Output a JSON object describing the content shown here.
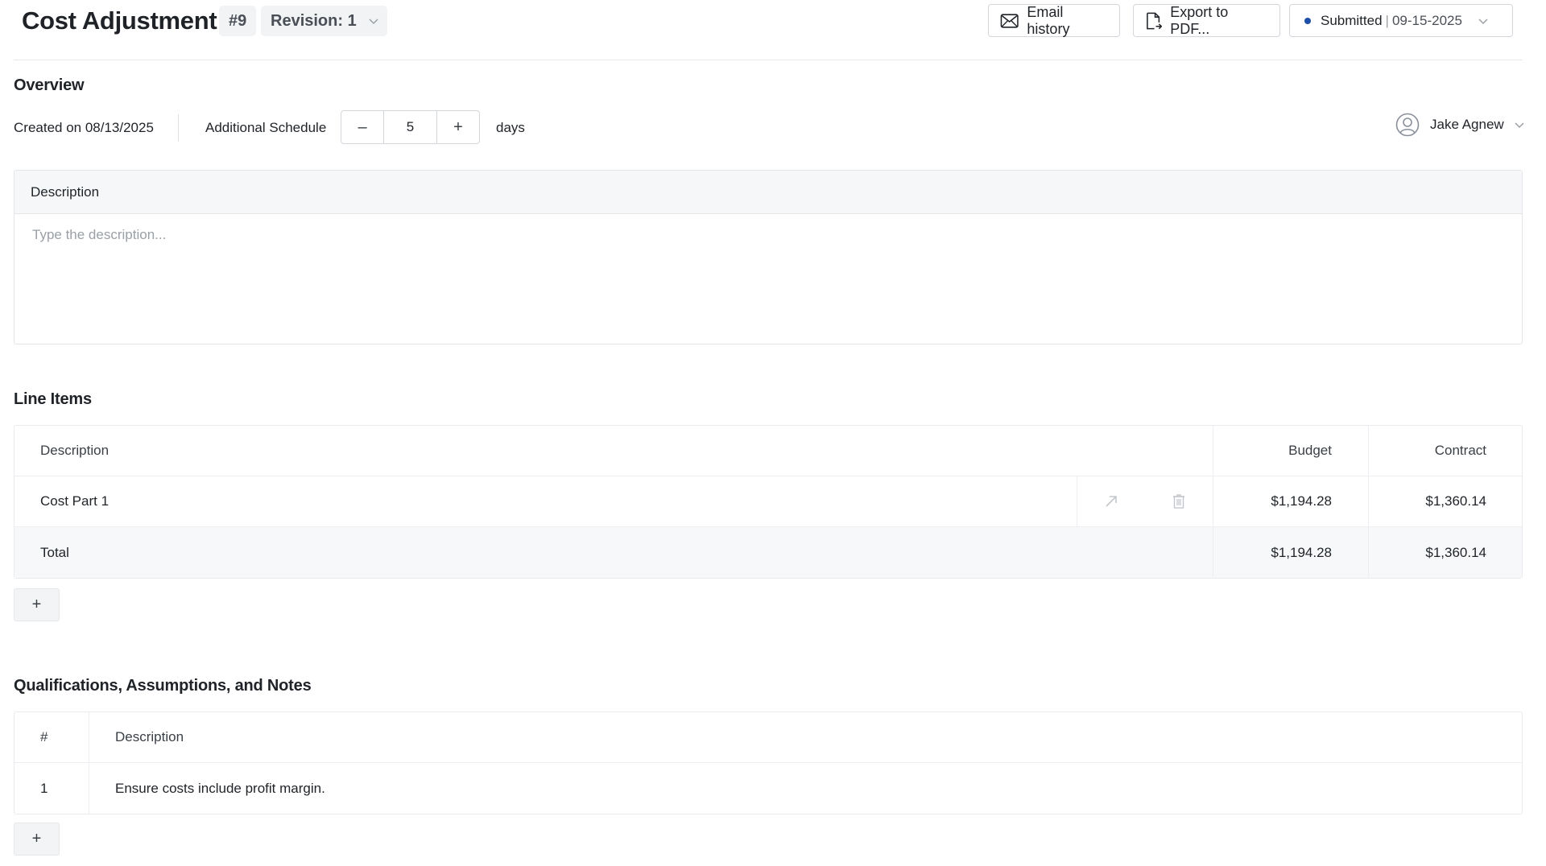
{
  "header": {
    "title": "Cost Adjustment",
    "number": "#9",
    "revision_label": "Revision: 1",
    "email_history_label": "Email history",
    "export_pdf_label": "Export to PDF...",
    "status_label": "Submitted",
    "status_separator": "|",
    "status_date": "09-15-2025",
    "status_color": "#1d4ea8"
  },
  "overview": {
    "section_title": "Overview",
    "created_text": "Created on 08/13/2025",
    "schedule_label": "Additional Schedule",
    "stepper_decrement": "–",
    "stepper_value": "5",
    "stepper_increment": "+",
    "unit_label": "days",
    "user_name": "Jake Agnew"
  },
  "description": {
    "header": "Description",
    "value": "",
    "placeholder": "Type the description..."
  },
  "line_items": {
    "section_title": "Line Items",
    "columns": {
      "description": "Description",
      "budget": "Budget",
      "contract": "Contract"
    },
    "rows": [
      {
        "description": "Cost Part 1",
        "budget": "$1,194.28",
        "contract": "$1,360.14"
      }
    ],
    "total": {
      "label": "Total",
      "budget": "$1,194.28",
      "contract": "$1,360.14"
    },
    "add_label": "+"
  },
  "notes": {
    "section_title": "Qualifications, Assumptions, and Notes",
    "columns": {
      "number": "#",
      "description": "Description"
    },
    "rows": [
      {
        "number": "1",
        "description": "Ensure costs include profit margin."
      }
    ],
    "add_label": "+"
  },
  "icons": {
    "email": "envelope-icon",
    "export": "document-export-icon",
    "chevron": "chevron-down-icon",
    "avatar": "user-circle-icon",
    "open": "arrow-up-right-icon",
    "delete": "trash-icon"
  }
}
